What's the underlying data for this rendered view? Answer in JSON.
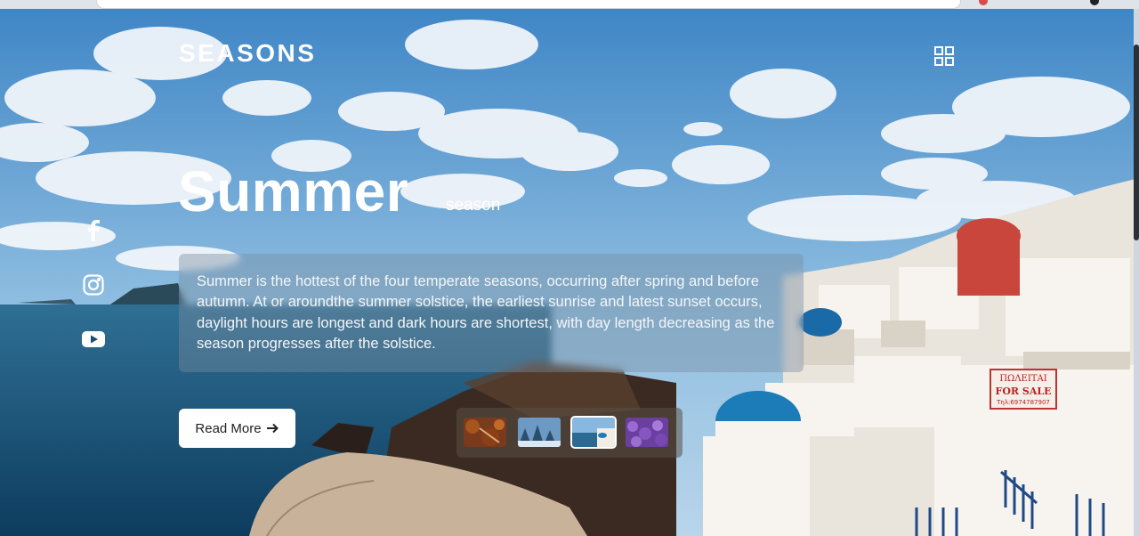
{
  "brand": {
    "logo": "SEASONS"
  },
  "hero": {
    "title": "Summer",
    "subtitle": "season",
    "description": "Summer is the hottest of the four temperate seasons, occurring after spring and before autumn. At or aroundthe summer solstice, the earliest sunrise and latest sunset occurs, daylight hours are longest and dark hours are shortest, with day length decreasing as the season progresses after the solstice.",
    "cta_label": "Read More",
    "cta_icon": "arrow-right-icon"
  },
  "social": [
    {
      "name": "facebook-icon"
    },
    {
      "name": "instagram-icon"
    },
    {
      "name": "youtube-icon"
    }
  ],
  "thumbnails": [
    {
      "name": "autumn-thumbnail",
      "active": false
    },
    {
      "name": "winter-thumbnail",
      "active": false
    },
    {
      "name": "summer-thumbnail",
      "active": true
    },
    {
      "name": "spring-thumbnail",
      "active": false
    }
  ],
  "colors": {
    "sky": "#6aa2d4",
    "sea": "#1f5d86",
    "button_bg": "#ffffff",
    "dome_blue": "#1b7cb8"
  }
}
